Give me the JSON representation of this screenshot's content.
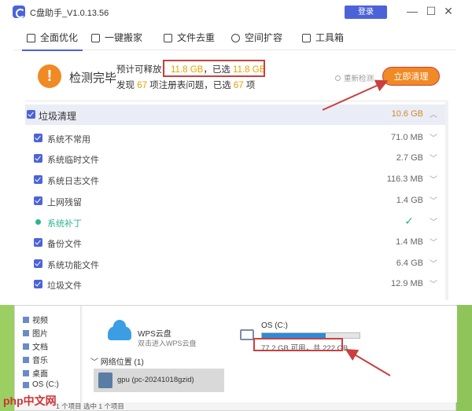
{
  "app": {
    "title": "C盘助手_V1.0.13.56",
    "login_label": "登录",
    "min_label": "—",
    "restore_label": "☐",
    "close_label": "✕"
  },
  "tabs": [
    {
      "label": "全面优化",
      "icon": "house-icon",
      "active": true
    },
    {
      "label": "一键搬家",
      "icon": "truck-icon",
      "active": false
    },
    {
      "label": "文件去重",
      "icon": "copy-icon",
      "active": false
    },
    {
      "label": "空间扩容",
      "icon": "gear-icon",
      "active": false
    },
    {
      "label": "工具箱",
      "icon": "toolbox-icon",
      "active": false
    }
  ],
  "summary": {
    "status": "检测完毕",
    "line1_prefix": "预计可释放：",
    "line1_value": "11.8 GB",
    "line1_mid": "，已选  ",
    "line1_selected": "11.8 GB",
    "line2_prefix": "发现 ",
    "line2_count": "67",
    "line2_mid": " 项注册表问题，已选  ",
    "line2_selected": "67",
    "line2_suffix": " 项",
    "rescan_label": "重新检测",
    "clean_label": "立即清理"
  },
  "list": {
    "header": {
      "name": "垃圾清理",
      "size": "10.6 GB"
    },
    "rows": [
      {
        "name": "系统不常用",
        "size": "71.0 MB",
        "type": "checkbox"
      },
      {
        "name": "系统临时文件",
        "size": "2.7 GB",
        "type": "checkbox"
      },
      {
        "name": "系统日志文件",
        "size": "116.3 MB",
        "type": "checkbox"
      },
      {
        "name": "上网残留",
        "size": "1.4 GB",
        "type": "checkbox"
      },
      {
        "name": "系统补丁",
        "size": "✓",
        "type": "dot"
      },
      {
        "name": "备份文件",
        "size": "1.4 MB",
        "type": "checkbox"
      },
      {
        "name": "系统功能文件",
        "size": "6.4 GB",
        "type": "checkbox"
      },
      {
        "name": "垃圾文件",
        "size": "12.9 MB",
        "type": "checkbox"
      }
    ]
  },
  "explorer": {
    "sidebar": [
      "视频",
      "图片",
      "文档",
      "音乐",
      "桌面",
      "OS (C:)"
    ],
    "wps_name": "WPS云盘",
    "wps_sub": "双击进入WPS云盘",
    "drive_name": "OS (C:)",
    "drive_used_fraction": 0.65,
    "drive_free": "77.2 GB 可用，共 222 GB",
    "network_head": "网络位置 (1)",
    "network_item": "gpu (pc-20241018gzid)",
    "status": "1 个项目   选中 1 个项目"
  },
  "brand": "php中文网",
  "colors": {
    "accent": "#4c63d8",
    "orange": "#f08a24",
    "highlight": "#c9403f"
  }
}
